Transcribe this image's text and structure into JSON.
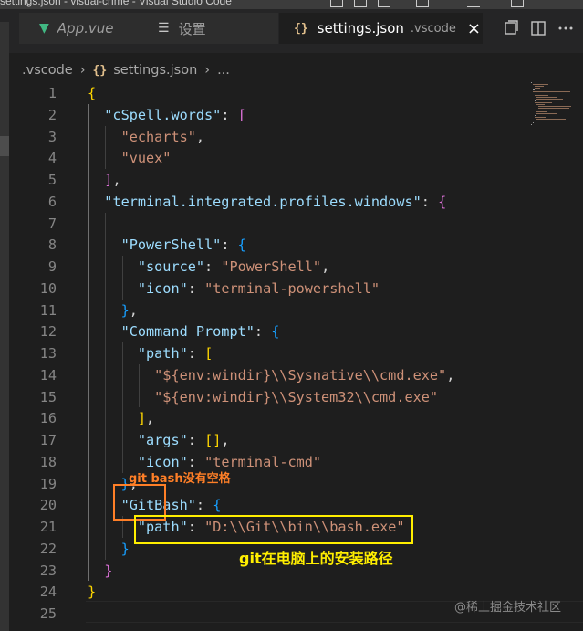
{
  "window": {
    "title": "settings.json - visual-crime - Visual Studio Code"
  },
  "tabs": [
    {
      "label": "App.vue",
      "icon": "vue-icon",
      "active": false
    },
    {
      "label": "设置",
      "icon": "settings-list-icon",
      "active": false
    },
    {
      "label": "settings.json",
      "description": ".vscode",
      "icon": "json-braces-icon",
      "active": true
    }
  ],
  "breadcrumb": {
    "folder": ".vscode",
    "file": "settings.json",
    "ellipsis": "..."
  },
  "editor": {
    "lines": [
      {
        "n": "1",
        "code": "{"
      },
      {
        "n": "2",
        "code": "  \"cSpell.words\": ["
      },
      {
        "n": "3",
        "code": "    \"echarts\","
      },
      {
        "n": "4",
        "code": "    \"vuex\""
      },
      {
        "n": "5",
        "code": "  ],"
      },
      {
        "n": "6",
        "code": "  \"terminal.integrated.profiles.windows\": {"
      },
      {
        "n": "7",
        "code": ""
      },
      {
        "n": "8",
        "code": "    \"PowerShell\": {"
      },
      {
        "n": "9",
        "code": "      \"source\": \"PowerShell\","
      },
      {
        "n": "10",
        "code": "      \"icon\": \"terminal-powershell\""
      },
      {
        "n": "11",
        "code": "    },"
      },
      {
        "n": "12",
        "code": "    \"Command Prompt\": {"
      },
      {
        "n": "13",
        "code": "      \"path\": ["
      },
      {
        "n": "14",
        "code": "        \"${env:windir}\\\\Sysnative\\\\cmd.exe\","
      },
      {
        "n": "15",
        "code": "        \"${env:windir}\\\\System32\\\\cmd.exe\""
      },
      {
        "n": "16",
        "code": "      ],"
      },
      {
        "n": "17",
        "code": "      \"args\": [],"
      },
      {
        "n": "18",
        "code": "      \"icon\": \"terminal-cmd\""
      },
      {
        "n": "19",
        "code": "    },"
      },
      {
        "n": "20",
        "code": "    \"GitBash\": {"
      },
      {
        "n": "21",
        "code": "      \"path\": \"D:\\\\Git\\\\bin\\\\bash.exe\""
      },
      {
        "n": "22",
        "code": "    }"
      },
      {
        "n": "23",
        "code": "  }"
      },
      {
        "n": "24",
        "code": "}"
      },
      {
        "n": "25",
        "code": ""
      }
    ]
  },
  "annotations": {
    "gitbash_note": "git bash没有空格",
    "path_note": "git在电脑上的安装路径",
    "note_color_orange": "#ff7f27",
    "note_color_yellow": "#ffee00"
  },
  "watermark": "@稀土掘金技术社区",
  "colors": {
    "editor_bg": "#1e1e1e",
    "key": "#9cdcfe",
    "string": "#ce9178",
    "bracket_level1": "#ffd700",
    "bracket_level2": "#da70d6",
    "bracket_level3": "#179fff"
  }
}
